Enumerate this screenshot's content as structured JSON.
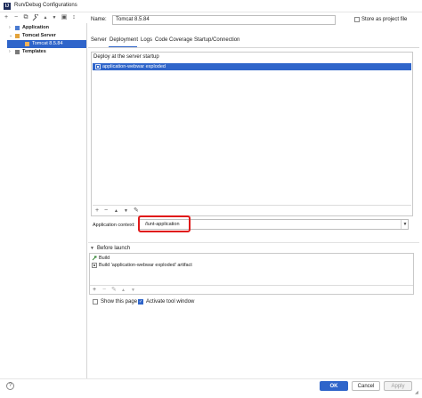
{
  "window": {
    "title": "Run/Debug Configurations",
    "logo": "IJ"
  },
  "left_toolbar": {
    "icons": [
      "plus-icon",
      "minus-icon",
      "copy-icon",
      "wrench-icon",
      "move-up-icon",
      "move-down-icon",
      "folder-icon",
      "sort-icon"
    ],
    "glyphs": [
      "+",
      "−",
      "⧉",
      "🔧",
      "▲",
      "▼",
      "▣",
      "↕"
    ]
  },
  "tree": {
    "items": [
      {
        "label": "Application",
        "level": 0,
        "expanded": false
      },
      {
        "label": "Tomcat Server",
        "level": 0,
        "expanded": true
      },
      {
        "label": "Tomcat 8.5.84",
        "level": 1,
        "selected": true
      },
      {
        "label": "Templates",
        "level": 0,
        "expanded": false
      }
    ]
  },
  "config": {
    "name_label": "Name:",
    "name_value": "Tomcat 8.5.84",
    "store_label": "Store as project file"
  },
  "tabs": [
    {
      "label": "Server",
      "active": false
    },
    {
      "label": "Deployment",
      "active": true
    },
    {
      "label": "Logs",
      "active": false
    },
    {
      "label": "Code Coverage",
      "active": false
    },
    {
      "label": "Startup/Connection",
      "active": false
    }
  ],
  "deployment": {
    "title": "Deploy at the server startup",
    "items": [
      "application-webwar exploded"
    ],
    "toolbar_glyphs": [
      "+",
      "−",
      "▲",
      "▼",
      "✎"
    ]
  },
  "context": {
    "label": "Application context:",
    "value": "/lunt-application",
    "highlight_color": "#e01818"
  },
  "before_launch": {
    "title": "Before launch",
    "items": [
      {
        "label": "Build",
        "icon": "hammer-icon"
      },
      {
        "label": "Build 'application-webwar exploded' artifact",
        "icon": "artifact-icon"
      }
    ],
    "toolbar_glyphs": [
      "+",
      "−",
      "✎",
      "▲",
      "▼"
    ]
  },
  "options": {
    "show_page_label": "Show this page",
    "show_page_checked": false,
    "activate_label": "Activate tool window",
    "activate_checked": true
  },
  "buttons": {
    "help": "?",
    "ok": "OK",
    "cancel": "Cancel",
    "apply": "Apply"
  },
  "colors": {
    "accent": "#2f65ca"
  }
}
